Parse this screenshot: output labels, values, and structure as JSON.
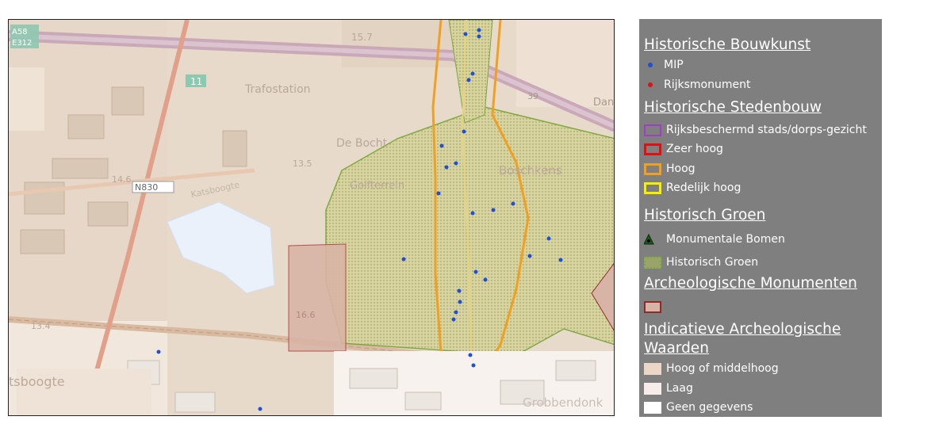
{
  "map": {
    "labels": {
      "road_a58": "A58",
      "road_e312": "E312",
      "road_n830": "N830",
      "exit_11": "11",
      "tretestation": "Trafostation",
      "de_bocht": "De Bocht",
      "boschkens": "Boschkens",
      "golfterrein": "Golfterrein",
      "katsboogte": "Katsboogte",
      "tsboogte": "tsboogte",
      "grobbendonk": "Grobbendonk",
      "dan": "Dan",
      "h_15_7": "15.7",
      "h_13_5": "13.5",
      "h_14_6": "14.6",
      "h_13_4": "13.4",
      "h_16_6": "16.6",
      "h_39": "39"
    },
    "colors": {
      "base": "#e9dccd",
      "motorway": "#c9a9b8",
      "rail": "#e0a08a",
      "historic_green": "#d9d6a0",
      "green_border": "#7aa83a",
      "orange_line": "#f0a020",
      "archeo": "#d8b4a6",
      "mip": "#1f4fd6"
    },
    "mip_points": [
      [
        586,
        42
      ],
      [
        603,
        37
      ],
      [
        603,
        45
      ],
      [
        595,
        92
      ],
      [
        590,
        100
      ],
      [
        584,
        165
      ],
      [
        556,
        183
      ],
      [
        562,
        210
      ],
      [
        574,
        205
      ],
      [
        552,
        243
      ],
      [
        595,
        268
      ],
      [
        621,
        264
      ],
      [
        646,
        256
      ],
      [
        691,
        300
      ],
      [
        667,
        322
      ],
      [
        706,
        327
      ],
      [
        508,
        326
      ],
      [
        599,
        342
      ],
      [
        611,
        352
      ],
      [
        578,
        366
      ],
      [
        579,
        380
      ],
      [
        574,
        393
      ],
      [
        571,
        402
      ],
      [
        592,
        447
      ],
      [
        596,
        460
      ],
      [
        199,
        443
      ],
      [
        327,
        515
      ]
    ]
  },
  "legend": {
    "sections": [
      {
        "title": "Historische Bouwkunst"
      },
      {
        "title": "Historische Stedenbouw"
      },
      {
        "title": "Historisch Groen"
      },
      {
        "title": "Archeologische Monumenten"
      },
      {
        "title_line1": "Indicatieve Archeologische",
        "title_line2": "Waarden"
      }
    ],
    "items": {
      "mip": "MIP",
      "rijksmonument": "Rijksmonument",
      "rijksbeschermd": "Rijksbeschermd stads/dorps-gezicht",
      "zeer_hoog": "Zeer hoog",
      "hoog": "Hoog",
      "redelijk_hoog": "Redelijk hoog",
      "monumentale_bomen": "Monumentale Bomen",
      "historisch_groen": "Historisch Groen",
      "hoog_middelhoog": "Hoog of middelhoog",
      "laag": "Laag",
      "geen_gegevens": "Geen gegevens"
    },
    "colors": {
      "mip": "#1f4fd6",
      "rijksmonument": "#e01010",
      "rijksbeschermd": "#a040c0",
      "zeer_hoog": "#e01010",
      "hoog": "#f0a020",
      "redelijk_hoog": "#f5f000",
      "archeo_monument": "#d8b4a6",
      "hoog_middelhoog": "#ecd6c8",
      "laag": "#f6ecea",
      "geen_gegevens": "#ffffff"
    }
  }
}
